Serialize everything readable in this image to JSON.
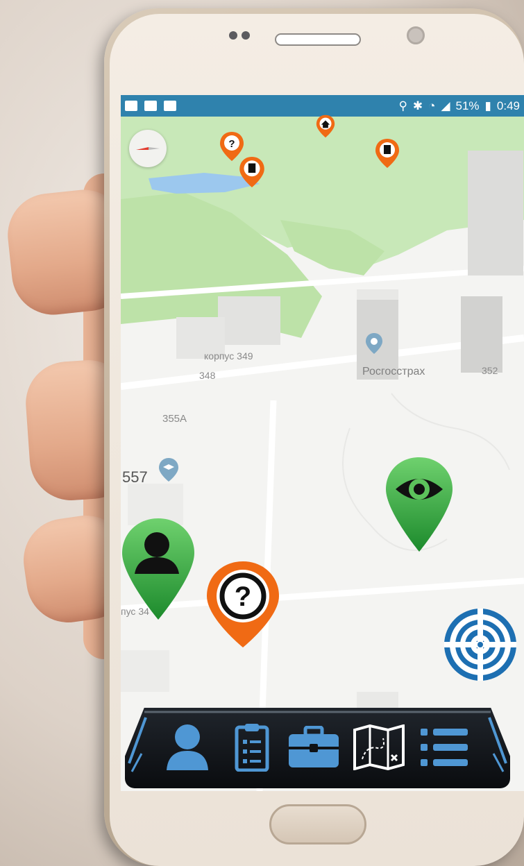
{
  "status_bar": {
    "battery": "51%",
    "time": "0:49"
  },
  "map": {
    "labels": {
      "korpus": "корпус 349",
      "building_348": "348",
      "building_355a": "355А",
      "rosgosstrakh": "Росгосстрах",
      "building_352": "352",
      "building_557": "557",
      "korpus_partial": "пус 34"
    },
    "small_markers": [
      "question-icon",
      "document-icon",
      "home-icon",
      "document-icon"
    ],
    "large_markers": [
      "eye-icon",
      "user-icon",
      "question-icon"
    ]
  },
  "bottom_nav": {
    "items": [
      "user-icon",
      "clipboard-icon",
      "briefcase-icon",
      "map-icon",
      "list-icon"
    ]
  },
  "colors": {
    "status_bar": "#2f82ad",
    "green_marker": "#2fa63c",
    "orange_marker": "#f06a14",
    "nav_blue": "#4f97d4",
    "target_blue": "#1d6fb2"
  }
}
